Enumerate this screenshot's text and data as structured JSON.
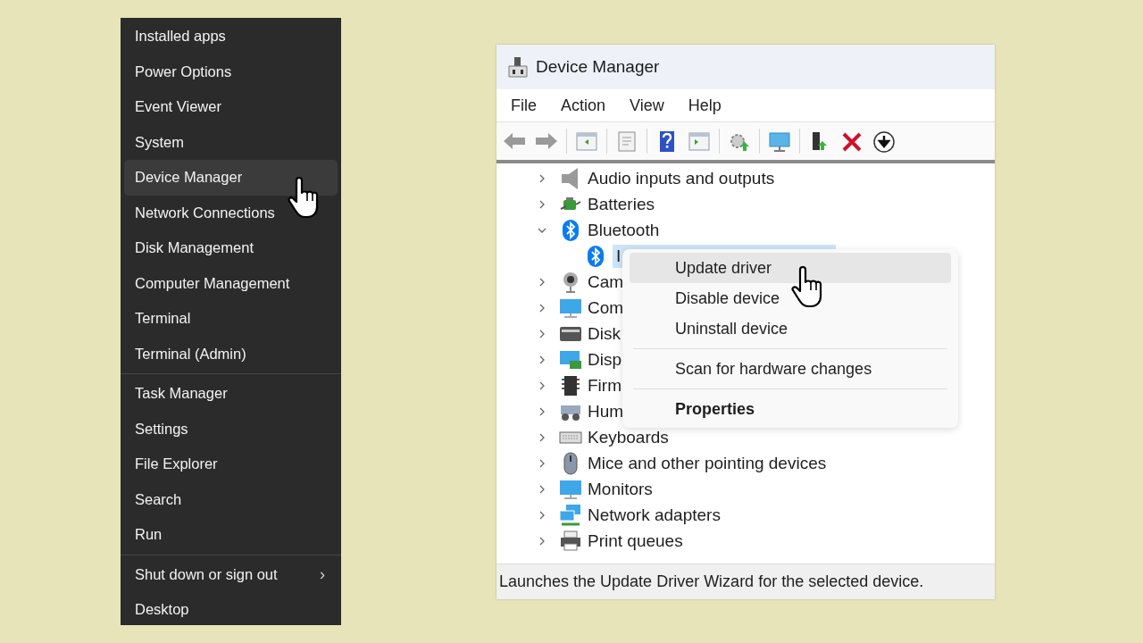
{
  "start_menu": {
    "groups": [
      [
        {
          "label": "Installed apps",
          "selected": false
        },
        {
          "label": "Power Options",
          "selected": false
        },
        {
          "label": "Event Viewer",
          "selected": false
        },
        {
          "label": "System",
          "selected": false
        },
        {
          "label": "Device Manager",
          "selected": true
        },
        {
          "label": "Network Connections",
          "selected": false
        },
        {
          "label": "Disk Management",
          "selected": false
        },
        {
          "label": "Computer Management",
          "selected": false
        },
        {
          "label": "Terminal",
          "selected": false
        },
        {
          "label": "Terminal (Admin)",
          "selected": false
        }
      ],
      [
        {
          "label": "Task Manager",
          "selected": false
        },
        {
          "label": "Settings",
          "selected": false
        },
        {
          "label": "File Explorer",
          "selected": false
        },
        {
          "label": "Search",
          "selected": false
        },
        {
          "label": "Run",
          "selected": false
        }
      ],
      [
        {
          "label": "Shut down or sign out",
          "selected": false,
          "arrow": "›"
        },
        {
          "label": "Desktop",
          "selected": false
        }
      ]
    ]
  },
  "device_manager": {
    "title": "Device Manager",
    "menu": [
      "File",
      "Action",
      "View",
      "Help"
    ],
    "tree": [
      {
        "kind": "audio",
        "label": "Audio inputs and outputs",
        "expanded": false,
        "selected": false
      },
      {
        "kind": "battery",
        "label": "Batteries",
        "expanded": false,
        "selected": false
      },
      {
        "kind": "bluetooth",
        "label": "Bluetooth",
        "expanded": true,
        "selected": false,
        "children": [
          {
            "kind": "bluetooth",
            "label": "I",
            "selected": true
          }
        ]
      },
      {
        "kind": "camera",
        "label": "Cam",
        "expanded": false,
        "selected": false
      },
      {
        "kind": "computer",
        "label": "Com",
        "expanded": false,
        "selected": false
      },
      {
        "kind": "disk",
        "label": "Disk",
        "expanded": false,
        "selected": false
      },
      {
        "kind": "display",
        "label": "Disp",
        "expanded": false,
        "selected": false
      },
      {
        "kind": "firmware",
        "label": "Firm",
        "expanded": false,
        "selected": false
      },
      {
        "kind": "hid",
        "label": "Hum",
        "expanded": false,
        "selected": false
      },
      {
        "kind": "keyboard",
        "label": "Keyboards",
        "expanded": false,
        "selected": false
      },
      {
        "kind": "mouse",
        "label": "Mice and other pointing devices",
        "expanded": false,
        "selected": false
      },
      {
        "kind": "monitor",
        "label": "Monitors",
        "expanded": false,
        "selected": false
      },
      {
        "kind": "network",
        "label": "Network adapters",
        "expanded": false,
        "selected": false
      },
      {
        "kind": "printer",
        "label": "Print queues",
        "expanded": false,
        "selected": false
      }
    ],
    "context_menu": [
      {
        "kind": "item",
        "label": "Update driver",
        "selected": true,
        "default": false
      },
      {
        "kind": "item",
        "label": "Disable device",
        "selected": false,
        "default": false
      },
      {
        "kind": "item",
        "label": "Uninstall device",
        "selected": false,
        "default": false
      },
      {
        "kind": "separator"
      },
      {
        "kind": "item",
        "label": "Scan for hardware changes",
        "selected": false,
        "default": false
      },
      {
        "kind": "separator"
      },
      {
        "kind": "item",
        "label": "Properties",
        "selected": false,
        "default": true
      }
    ],
    "status_bar": "Launches the Update Driver Wizard for the selected device."
  }
}
